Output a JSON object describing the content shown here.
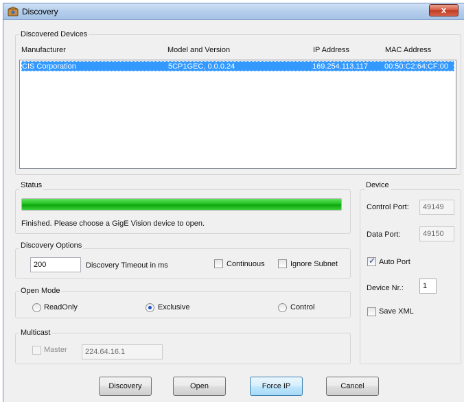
{
  "window": {
    "title": "Discovery",
    "close_label": "x"
  },
  "discovered": {
    "group_label": "Discovered Devices",
    "columns": [
      "Manufacturer",
      "Model and Version",
      "IP Address",
      "MAC Address"
    ],
    "rows": [
      [
        "CIS Corporation",
        "5CP1GEC, 0.0.0.24",
        "169.254.113.117",
        "00:50:C2:64:CF:00"
      ]
    ]
  },
  "status": {
    "group_label": "Status",
    "progress": 1.0,
    "message": "Finished. Please choose a GigE Vision device to open."
  },
  "discovery_options": {
    "group_label": "Discovery Options",
    "timeout_value": "200",
    "timeout_label": "Discovery Timeout in ms",
    "continuous_label": "Continuous",
    "continuous_checked": false,
    "ignore_subnet_label": "Ignore Subnet",
    "ignore_subnet_checked": false
  },
  "open_mode": {
    "group_label": "Open Mode",
    "options": [
      "ReadOnly",
      "Exclusive",
      "Control"
    ],
    "selected": "Exclusive"
  },
  "multicast": {
    "group_label": "Multicast",
    "master_label": "Master",
    "master_checked": false,
    "address": "224.64.16.1"
  },
  "device": {
    "group_label": "Device",
    "control_port_label": "Control Port:",
    "control_port_value": "49149",
    "data_port_label": "Data Port:",
    "data_port_value": "49150",
    "auto_port_label": "Auto Port",
    "auto_port_checked": true,
    "device_nr_label": "Device Nr.:",
    "device_nr_value": "1",
    "save_xml_label": "Save XML",
    "save_xml_checked": false
  },
  "buttons": {
    "discovery": "Discovery",
    "open": "Open",
    "force_ip": "Force IP",
    "cancel": "Cancel"
  },
  "colors": {
    "selection": "#3399ff",
    "progress": "#20c020",
    "titlebar": "#b3cdec"
  }
}
